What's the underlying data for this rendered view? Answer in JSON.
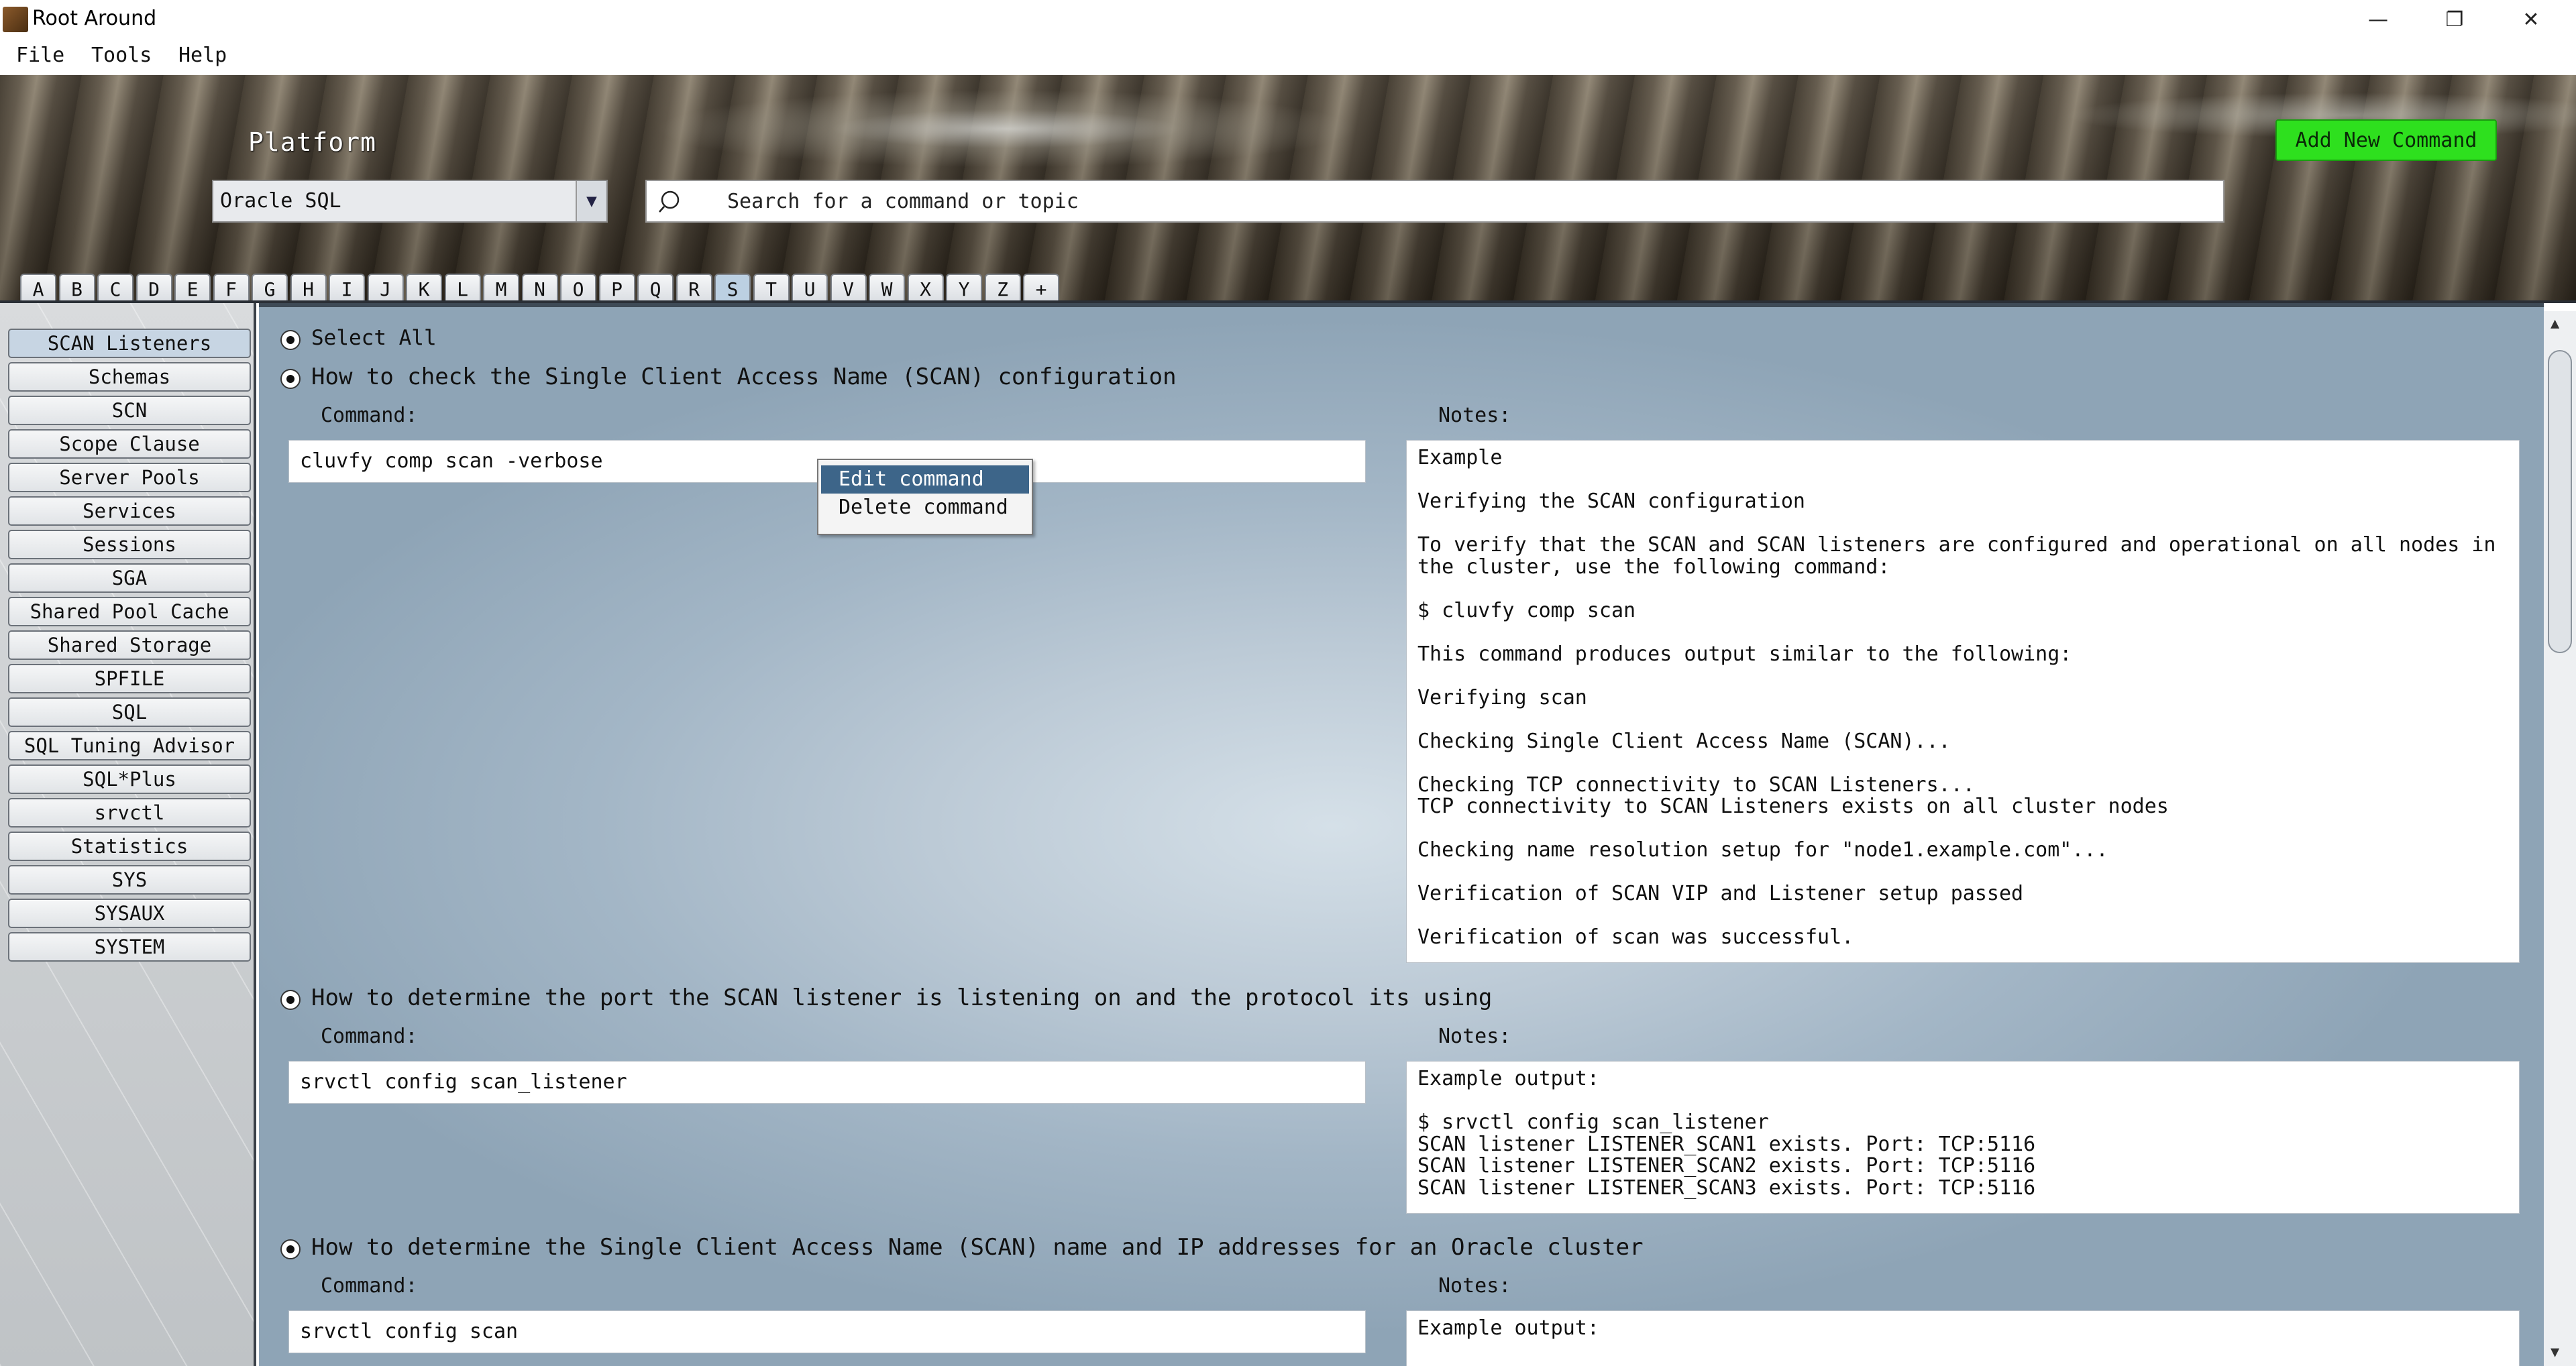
{
  "window": {
    "title": "Root Around",
    "minimize": "—",
    "restore": "❐",
    "close": "✕"
  },
  "menu": {
    "file": "File",
    "tools": "Tools",
    "help": "Help"
  },
  "header": {
    "platform_label": "Platform",
    "platform_value": "Oracle SQL",
    "search_placeholder": "Search for a command or topic",
    "add_button": "Add New Command",
    "letters": [
      "A",
      "B",
      "C",
      "D",
      "E",
      "F",
      "G",
      "H",
      "I",
      "J",
      "K",
      "L",
      "M",
      "N",
      "O",
      "P",
      "Q",
      "R",
      "S",
      "T",
      "U",
      "V",
      "W",
      "X",
      "Y",
      "Z",
      "+"
    ],
    "active_letter": "S"
  },
  "sidebar": {
    "items": [
      "SCAN Listeners",
      "Schemas",
      "SCN",
      "Scope Clause",
      "Server Pools",
      "Services",
      "Sessions",
      "SGA",
      "Shared Pool Cache",
      "Shared Storage",
      "SPFILE",
      "SQL",
      "SQL Tuning Advisor",
      "SQL*Plus",
      "srvctl",
      "Statistics",
      "SYS",
      "SYSAUX",
      "SYSTEM"
    ],
    "active": "SCAN Listeners"
  },
  "main": {
    "select_all": "Select All",
    "command_label": "Command:",
    "notes_label": "Notes:",
    "entries": [
      {
        "title": "How to check the Single Client Access Name (SCAN) configuration",
        "command": "cluvfy comp scan -verbose",
        "notes": [
          "Example",
          "",
          "Verifying the SCAN configuration",
          "",
          "To verify that the SCAN and SCAN listeners are configured and operational on all nodes in",
          "the cluster, use the following command:",
          "",
          "$ cluvfy comp scan",
          "",
          "This command produces output similar to the following:",
          "",
          "Verifying scan",
          "",
          "Checking Single Client Access Name (SCAN)...",
          "",
          "Checking TCP connectivity to SCAN Listeners...",
          "TCP connectivity to SCAN Listeners exists on all cluster nodes",
          "",
          "Checking name resolution setup for \"node1.example.com\"...",
          "",
          "Verification of SCAN VIP and Listener setup passed",
          "",
          "Verification of scan was successful."
        ]
      },
      {
        "title": "How to determine the port the SCAN listener is listening on and the protocol its using",
        "command": "srvctl config scan_listener",
        "notes": [
          "Example output:",
          "",
          "$ srvctl config scan_listener",
          "SCAN listener LISTENER_SCAN1 exists. Port: TCP:5116",
          "SCAN listener LISTENER_SCAN2 exists. Port: TCP:5116",
          "SCAN listener LISTENER_SCAN3 exists. Port: TCP:5116"
        ]
      },
      {
        "title": "How to determine the Single Client Access Name (SCAN) name and IP addresses for an Oracle cluster",
        "command": "srvctl config scan",
        "notes": [
          "Example output:"
        ]
      }
    ]
  },
  "context_menu": {
    "edit": "Edit command",
    "delete": "Delete command"
  },
  "scrollbar": {
    "up": "▲",
    "down": "▼"
  },
  "colors": {
    "add_button": "#2ee01e",
    "context_highlight": "#3d6589"
  }
}
